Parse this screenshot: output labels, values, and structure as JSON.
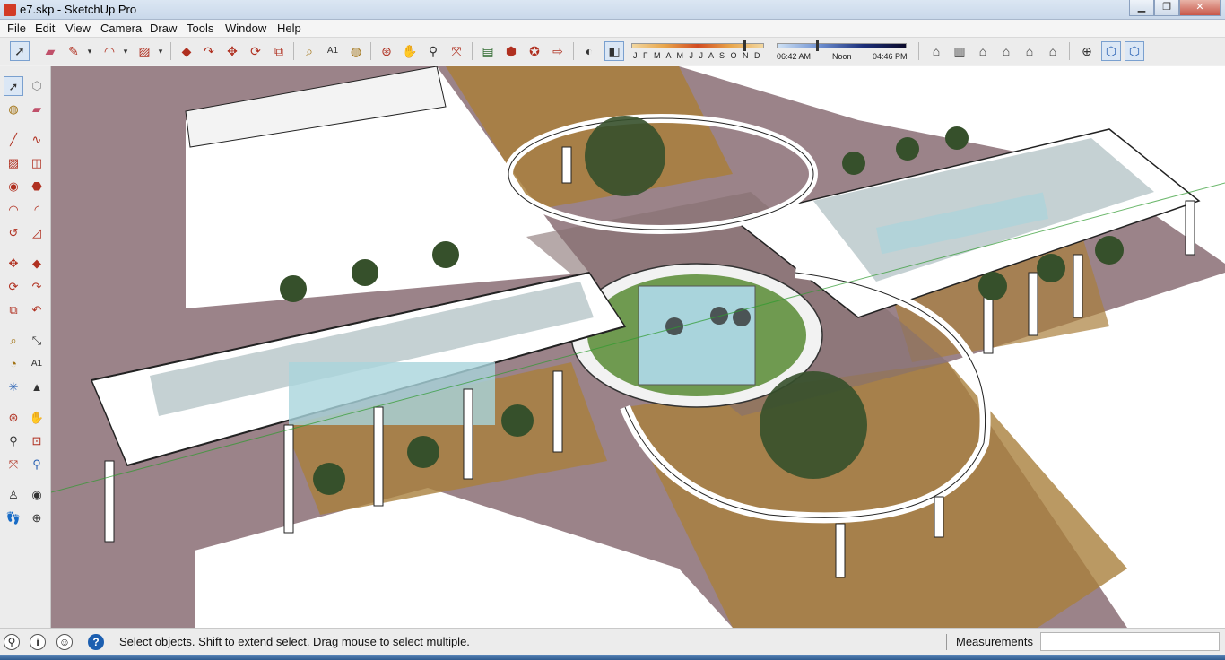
{
  "window": {
    "title": "e7.skp - SketchUp Pro",
    "min": "▁",
    "max": "❐",
    "close": "✕"
  },
  "menu": [
    "File",
    "Edit",
    "View",
    "Camera",
    "Draw",
    "Tools",
    "Window",
    "Help"
  ],
  "shadow": {
    "months": "J F M A M J J A S O N D",
    "time_start": "06:42 AM",
    "time_mid": "Noon",
    "time_end": "04:46 PM"
  },
  "status": {
    "message": "Select objects. Shift to extend select. Drag mouse to select multiple.",
    "measurements_label": "Measurements",
    "measurements_value": ""
  },
  "colors": {
    "ground": "#9b8389",
    "paving_dark": "#86706f",
    "paving_brown": "#a97f3c",
    "water": "#a9d4dc",
    "grass": "#6f9a50",
    "tree": "#36502b",
    "structure": "#ffffff"
  }
}
